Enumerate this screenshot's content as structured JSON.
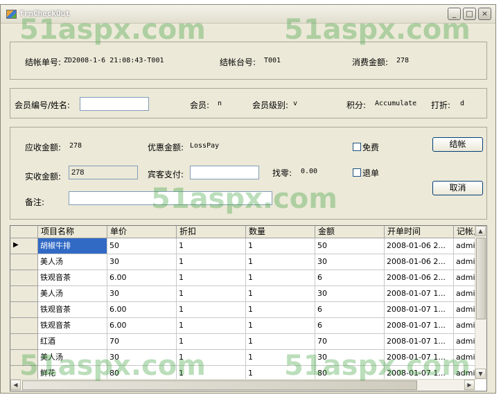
{
  "window": {
    "title": "frmCheckOut",
    "min": "_",
    "max": "□",
    "close": "×"
  },
  "checkout": {
    "bill_no_label": "结帐单号:",
    "bill_no": "ZD2008-1-6 21:08:43-T001",
    "table_label": "结帐台号:",
    "table": "T001",
    "amount_label": "消费金额:",
    "amount": "278"
  },
  "member": {
    "id_label": "会员编号/姓名:",
    "id_value": "",
    "member_label": "会员:",
    "member_value": "n",
    "level_label": "会员级别:",
    "level_value": "v",
    "points_label": "积分:",
    "points_value": "Accumulate",
    "discount_label": "打折:",
    "discount_value": "d"
  },
  "payment": {
    "receivable_label": "应收金额:",
    "receivable": "278",
    "preferential_label": "优惠金额:",
    "preferential": "LossPay",
    "free_label": "免费",
    "checkout_button": "结帐",
    "actual_label": "实收金额:",
    "actual": "278",
    "guest_pay_label": "宾客支付:",
    "guest_pay": "",
    "change_label": "找零:",
    "change": "0.00",
    "return_label": "退单",
    "cancel_button": "取消",
    "remark_label": "备注:",
    "remark": ""
  },
  "grid": {
    "columns": [
      "项目名称",
      "单价",
      "折扣",
      "数量",
      "金额",
      "开单时间",
      "记帐人"
    ],
    "rows": [
      [
        "胡椒牛排",
        "50",
        "1",
        "1",
        "50",
        "2008-01-06 2...",
        "admin"
      ],
      [
        "美人汤",
        "30",
        "1",
        "1",
        "30",
        "2008-01-06 2...",
        "admin"
      ],
      [
        "铁观音茶",
        "6.00",
        "1",
        "1",
        "6",
        "2008-01-06 2...",
        "admin"
      ],
      [
        "美人汤",
        "30",
        "1",
        "1",
        "30",
        "2008-01-07 1...",
        "admin"
      ],
      [
        "铁观音茶",
        "6.00",
        "1",
        "1",
        "6",
        "2008-01-07 1...",
        "admin"
      ],
      [
        "铁观音茶",
        "6.00",
        "1",
        "1",
        "6",
        "2008-01-07 1...",
        "admin"
      ],
      [
        "红酒",
        "70",
        "1",
        "1",
        "70",
        "2008-01-07 1...",
        "admin"
      ],
      [
        "美人汤",
        "30",
        "1",
        "1",
        "30",
        "2008-01-07 1...",
        "admin"
      ],
      [
        "鲜花",
        "80",
        "1",
        "1",
        "80",
        "2008-01-07 1...",
        "admin"
      ]
    ],
    "current_row_marker": "▶"
  },
  "watermark": "51aspx.com",
  "icons": {
    "up": "▲",
    "down": "▼",
    "left": "◀",
    "right": "▶"
  }
}
